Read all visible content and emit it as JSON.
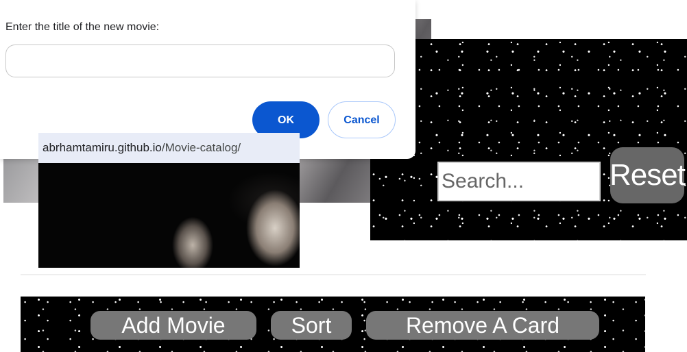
{
  "dialog": {
    "message": "Enter the title of the new movie:",
    "input_value": "",
    "ok_label": "OK",
    "cancel_label": "Cancel"
  },
  "origin": {
    "host": "abrhamtamiru.github.io",
    "path": "/Movie-catalog/"
  },
  "search": {
    "placeholder": "Search...",
    "reset_label": "Reset"
  },
  "actions": {
    "add_label": "Add Movie",
    "sort_label": "Sort",
    "remove_label": "Remove A Card"
  },
  "colors": {
    "primary_blue": "#0b57d0",
    "button_gray": "#777777",
    "reset_gray": "#676767"
  }
}
